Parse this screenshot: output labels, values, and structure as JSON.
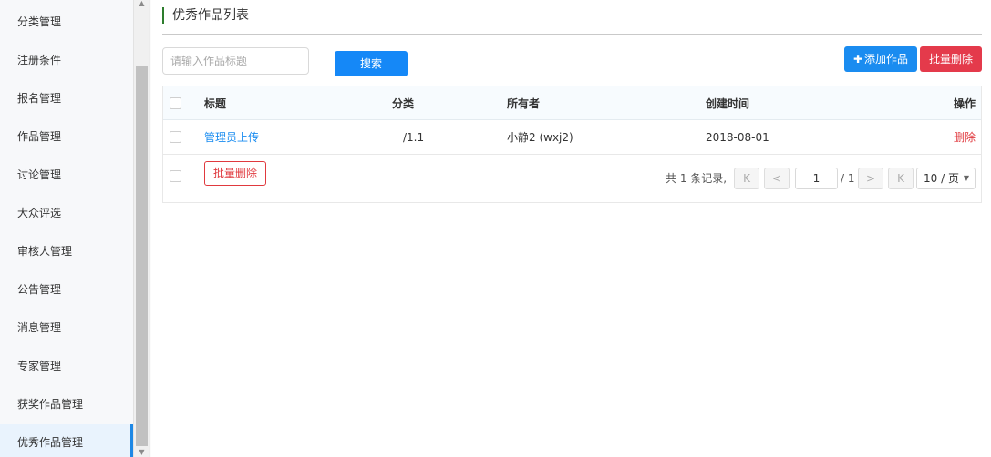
{
  "sidebar": {
    "items": [
      {
        "label": "分类管理"
      },
      {
        "label": "注册条件"
      },
      {
        "label": "报名管理"
      },
      {
        "label": "作品管理"
      },
      {
        "label": "讨论管理"
      },
      {
        "label": "大众评选"
      },
      {
        "label": "审核人管理"
      },
      {
        "label": "公告管理"
      },
      {
        "label": "消息管理"
      },
      {
        "label": "专家管理"
      },
      {
        "label": "获奖作品管理"
      },
      {
        "label": "优秀作品管理"
      }
    ],
    "active_index": 11
  },
  "page": {
    "title": "优秀作品列表"
  },
  "toolbar": {
    "search_placeholder": "请输入作品标题",
    "search_value": "",
    "search_label": "搜索",
    "add_plus": "✚",
    "add_label": "添加作品",
    "batch_delete_label": "批量删除"
  },
  "table": {
    "headers": {
      "title": "标题",
      "category": "分类",
      "owner": "所有者",
      "created": "创建时间",
      "actions": "操作"
    },
    "rows": [
      {
        "title": "管理员上传",
        "category": "一/1.1",
        "owner": "小静2 (wxj2)",
        "created": "2018-08-01",
        "action": "删除"
      }
    ],
    "footer_batch_delete": "批量删除"
  },
  "pagination": {
    "summary": "共 1 条记录,",
    "first_icon": "K",
    "prev_icon": "<",
    "current_page": "1",
    "total_pages_text": "/ 1",
    "next_icon": ">",
    "last_icon": "K",
    "page_size": "10 / 页"
  },
  "colors": {
    "primary": "#1588f7",
    "danger": "#e43a4b",
    "title_accent": "#2d7d2d",
    "active_item_bg": "#e9f3fd"
  }
}
